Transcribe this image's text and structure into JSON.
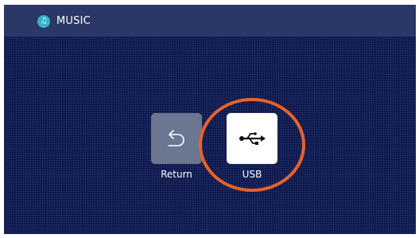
{
  "header": {
    "title": "MUSIC",
    "icon": "music-note-icon"
  },
  "menu": {
    "items": [
      {
        "label": "Return",
        "icon": "return-arrow-icon"
      },
      {
        "label": "USB",
        "icon": "usb-icon"
      }
    ],
    "selected": "USB"
  },
  "colors": {
    "background": "#0c184e",
    "header_bar": "#2a3767",
    "return_tile": "#6b7691",
    "usb_tile": "#ffffff",
    "highlight": "#e8622a",
    "header_icon": "#3bb0c9"
  }
}
